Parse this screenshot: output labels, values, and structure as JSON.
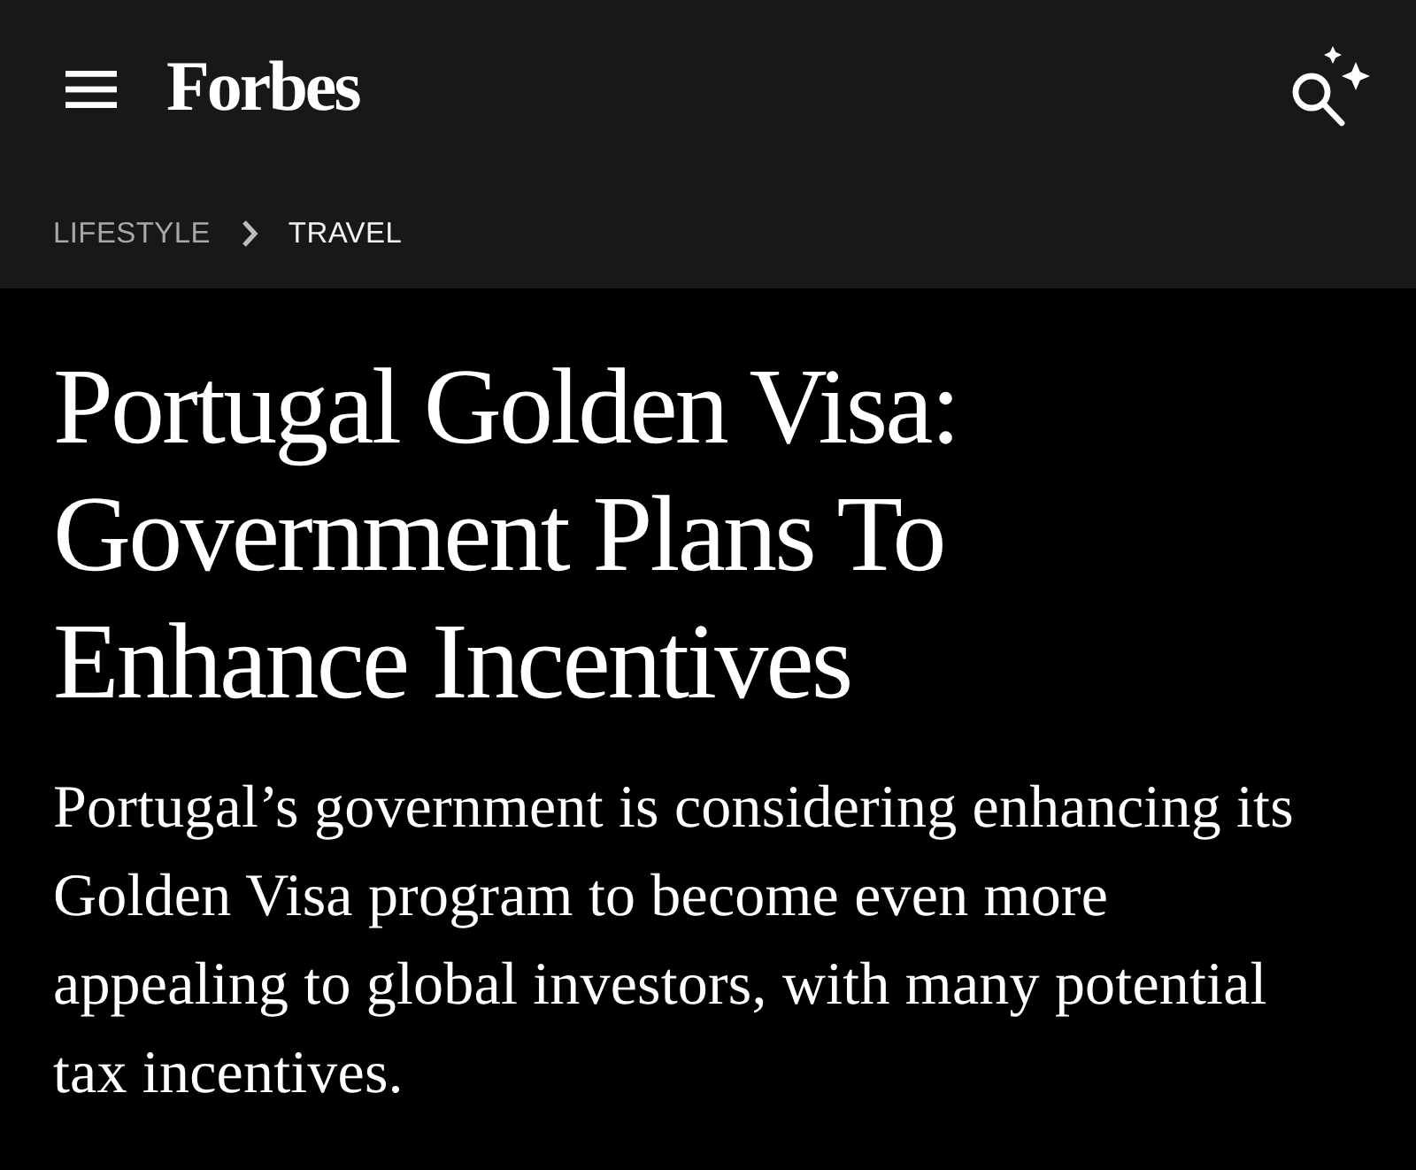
{
  "header": {
    "logo": "Forbes"
  },
  "breadcrumb": [
    {
      "label": "LIFESTYLE",
      "current": false
    },
    {
      "label": "TRAVEL",
      "current": true
    }
  ],
  "article": {
    "headline": "Portugal Golden Visa: Government Plans To Enhance Incentives",
    "summary": "Portugal’s government is considering enhancing its Golden Visa program to become even more appealing to global investors, with many potential tax incentives."
  }
}
